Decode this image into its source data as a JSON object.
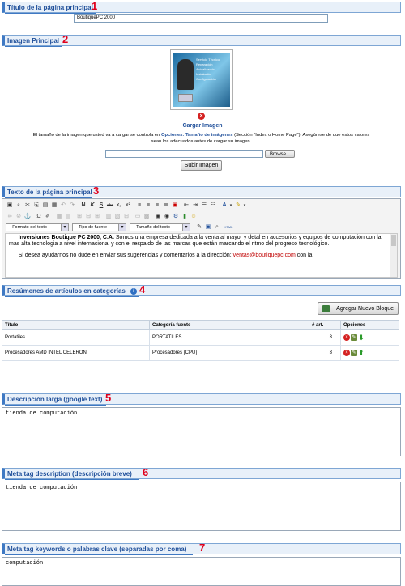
{
  "section1": {
    "title": "Título de la página principal",
    "number": "1",
    "input_value": "BoutiquePC 2000"
  },
  "section2": {
    "title": "Imagen Principal",
    "number": "2",
    "image_text": "Servicio Técnico\nReparación\nActualización\nInstalación\nConfiguración",
    "upload_link": "Cargar Imagen",
    "info_pre": "El tamaño de la imagen que usted va a cargar se controla en ",
    "info_link": "Opciones: Tamaño de imágenes",
    "info_post": " (Sección \"Index o  Home Page\"). Asegúrese de que estos valores",
    "info_line2": "sean los adecuados antes de cargar su imagen.",
    "browse_label": "Browse...",
    "submit_label": "Subir Imagen"
  },
  "section3": {
    "title": "Texto de la página principal",
    "number": "3",
    "format_select": "-- Formato del texto --",
    "font_select": "-- Tipo de fuente --",
    "size_select": "-- Tamaño del texto --",
    "para1_bold": "Inversiones Boutique PC 2000, C.A.",
    "para1_rest": " Somos una empresa dedicada a la venta al mayor y detal en accesorios y equipos de computación con la mas alta tecnologia a nivel internacional y con el respaldo de las marcas que están marcando el ritmo del progreso tecnológico.",
    "para2_pre": "Si desea ayudarnos no dude en enviar sus sugerencias y comentarios a la dirección: ",
    "para2_link": "ventas@boutiquepc.com",
    "para2_post": " con la"
  },
  "section4": {
    "title": "Resúmenes de artículos en categorías",
    "number": "4",
    "add_button": "Agregar Nuevo Bloque",
    "columns": [
      "Título",
      "Categoría fuente",
      "# art.",
      "Opciones"
    ],
    "rows": [
      {
        "title": "Portatiles",
        "category": "PORTATILES",
        "count": "3"
      },
      {
        "title": "Procesadores AMD INTEL CELERON",
        "category": "Procesadores (CPU)",
        "count": "3"
      }
    ]
  },
  "section5": {
    "title": "Descripción larga (google text)",
    "number": "5",
    "value": "tienda de computación"
  },
  "section6": {
    "title": "Meta tag description (descripción breve)",
    "number": "6",
    "value": "tienda de computación"
  },
  "section7": {
    "title": "Meta tag keywords o palabras clave (separadas por coma)",
    "number": "7",
    "value": "computación"
  },
  "colors": {
    "header_bg": "#e8f0f9",
    "header_text": "#1f4f9a",
    "marker": "#e0001b",
    "link": "#1f4f9a"
  }
}
